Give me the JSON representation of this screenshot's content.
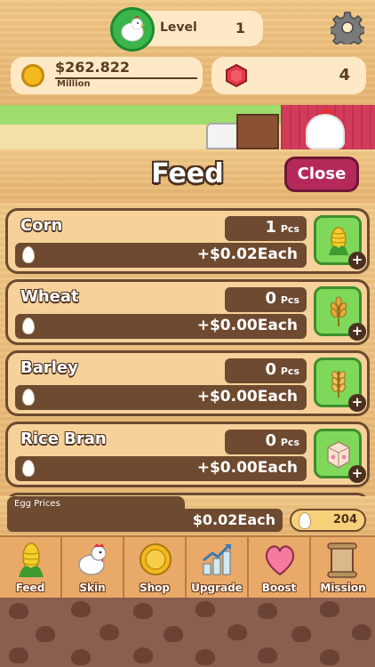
{
  "status": {
    "level_label": "Level",
    "level_value": "1",
    "money_amount": "$262.822",
    "money_unit": "Million",
    "gem_count": "4"
  },
  "feed_panel": {
    "title": "Feed",
    "close_label": "Close",
    "items": [
      {
        "name": "Corn",
        "qty": "1",
        "unit": "Pcs",
        "price": "+$0.02Each",
        "icon": "corn-icon"
      },
      {
        "name": "Wheat",
        "qty": "0",
        "unit": "Pcs",
        "price": "+$0.00Each",
        "icon": "wheat-icon"
      },
      {
        "name": "Barley",
        "qty": "0",
        "unit": "Pcs",
        "price": "+$0.00Each",
        "icon": "barley-icon"
      },
      {
        "name": "Rice Bran",
        "qty": "0",
        "unit": "Pcs",
        "price": "+$0.00Each",
        "icon": "rice-bran-bag-icon"
      }
    ]
  },
  "egg_bar": {
    "label": "Egg Prices",
    "price": "$0.02Each",
    "egg_count": "204"
  },
  "nav": [
    {
      "label": "Feed",
      "icon": "corn-icon"
    },
    {
      "label": "Skin",
      "icon": "chicken-icon"
    },
    {
      "label": "Shop",
      "icon": "coin-icon"
    },
    {
      "label": "Upgrade",
      "icon": "upgrade-chart-icon"
    },
    {
      "label": "Boost",
      "icon": "heart-icon"
    },
    {
      "label": "Mission",
      "icon": "scroll-icon"
    }
  ],
  "colors": {
    "wood": "#f1c987",
    "panel_dark": "#6e4a30",
    "feed_button": "#7fd85a",
    "close_button": "#b5295a",
    "gem": "#e23a48",
    "coin": "#f4b91f"
  }
}
